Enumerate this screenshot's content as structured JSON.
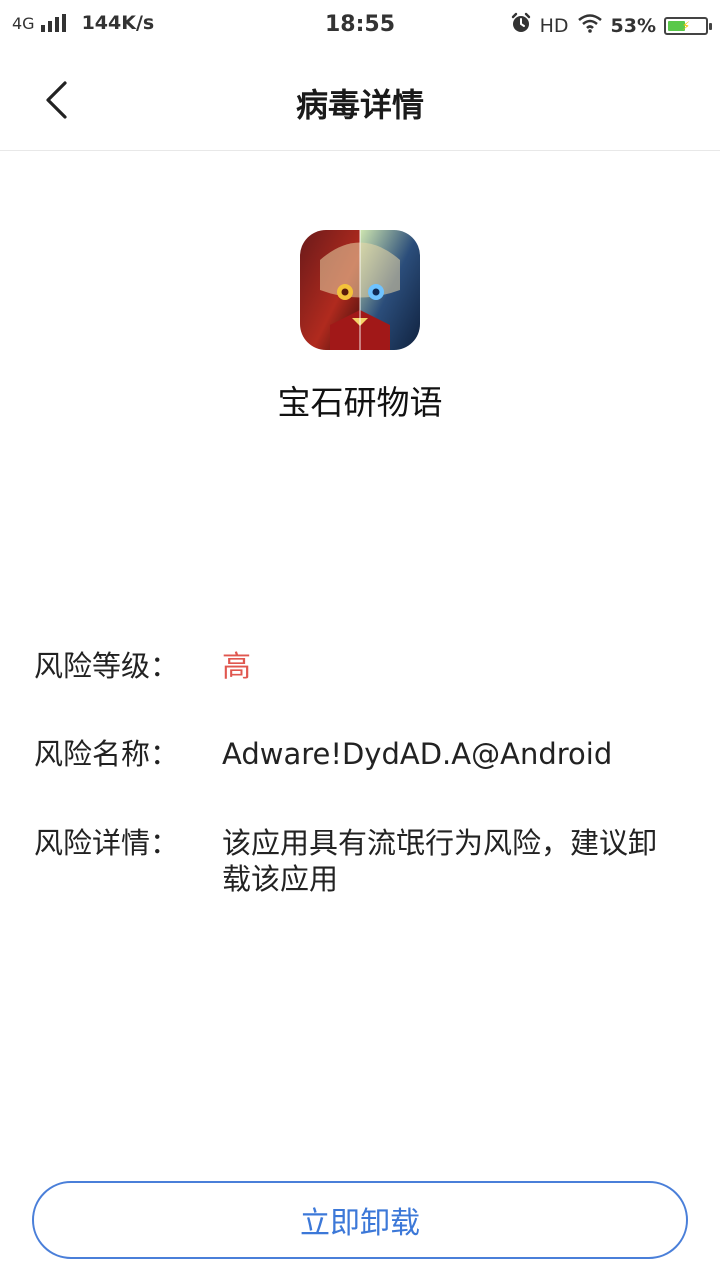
{
  "status_bar": {
    "network": "4G",
    "speed": "144K/s",
    "time": "18:55",
    "hd": "HD",
    "battery_percent": "53%",
    "battery_level": 0.53
  },
  "header": {
    "title": "病毒详情",
    "back_icon": "chevron-left-icon"
  },
  "app": {
    "name": "宝石研物语"
  },
  "details": {
    "risk_level_label": "风险等级：",
    "risk_level_value": "高",
    "risk_name_label": "风险名称：",
    "risk_name_value": "Adware!DydAD.A@Android",
    "risk_detail_label": "风险详情：",
    "risk_detail_value": "该应用具有流氓行为风险，建议卸载该应用"
  },
  "actions": {
    "uninstall_label": "立即卸载"
  },
  "colors": {
    "accent": "#3c78d8",
    "risk_high": "#e0574f"
  }
}
